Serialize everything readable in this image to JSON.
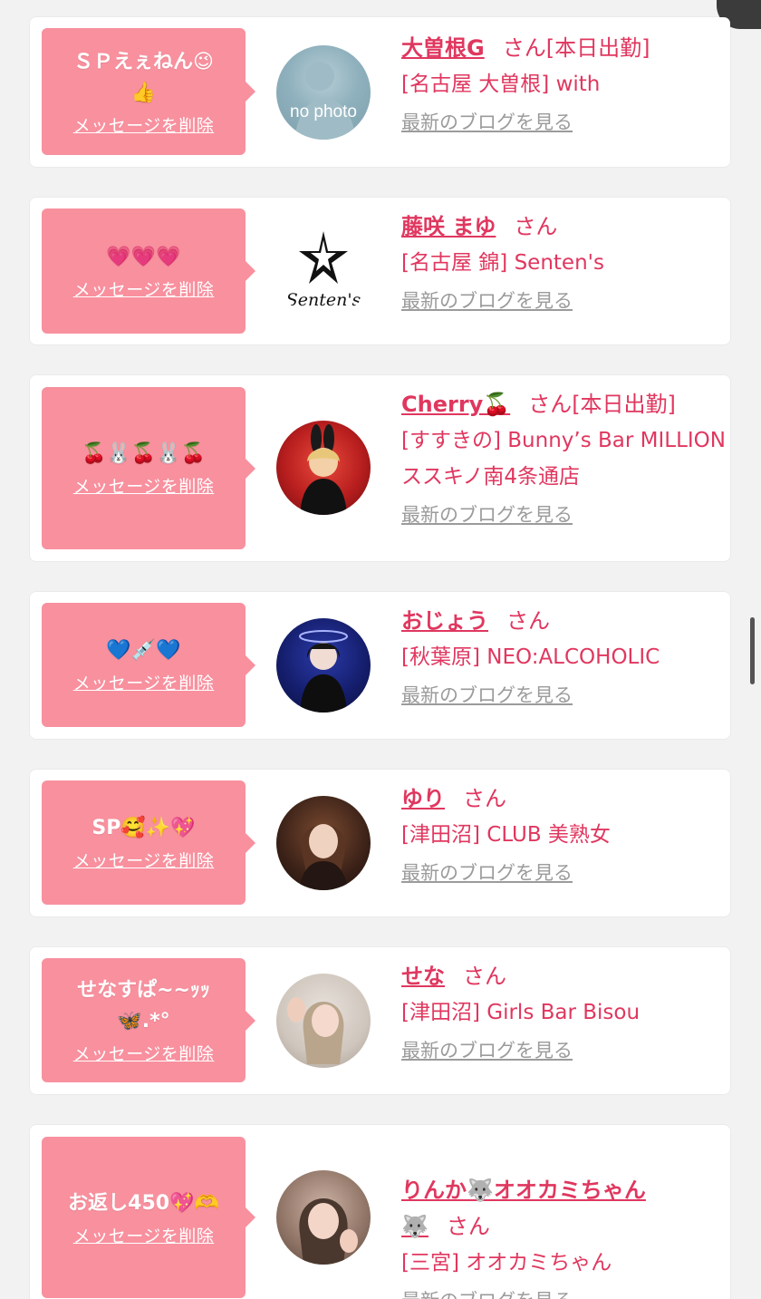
{
  "delete_label": "メッセージを削除",
  "blog_label": "最新のブログを見る",
  "san_label": "さん",
  "messages": [
    {
      "bubble_text": "ＳＰえぇねん😉\n👍",
      "name": "大曽根G",
      "tag": "[本日出勤]",
      "shop": "[名古屋 大曽根] with",
      "avatar_label": "no photo"
    },
    {
      "bubble_text": "💗💗💗",
      "name": "藤咲 まゆ",
      "tag": "",
      "shop": "[名古屋 錦] Senten's",
      "avatar_label": "Senten's"
    },
    {
      "bubble_text": "🍒🐰🍒🐰🍒",
      "name": "Cherry🍒",
      "tag": "[本日出勤]",
      "shop": "[すすきの] Bunny’s Bar MILLION ススキノ南4条通店",
      "avatar_label": ""
    },
    {
      "bubble_text": "💙💉💙",
      "name": "おじょう",
      "tag": "",
      "shop": "[秋葉原] NEO:ALCOHOLIC",
      "avatar_label": ""
    },
    {
      "bubble_text": "SP🥰✨💖",
      "name": "ゆり",
      "tag": "",
      "shop": "[津田沼] CLUB 美熟女",
      "avatar_label": ""
    },
    {
      "bubble_text": "せなすぱ~~ｯｯ\n🦋.*°",
      "name": "せな",
      "tag": "",
      "shop": "[津田沼] Girls Bar Bisou",
      "avatar_label": ""
    },
    {
      "bubble_text": "お返し450💖🫶",
      "name": "りんか🐺オオカミちゃん\n🐺",
      "tag": "",
      "shop": "[三宮] オオカミちゃん",
      "avatar_label": ""
    }
  ]
}
